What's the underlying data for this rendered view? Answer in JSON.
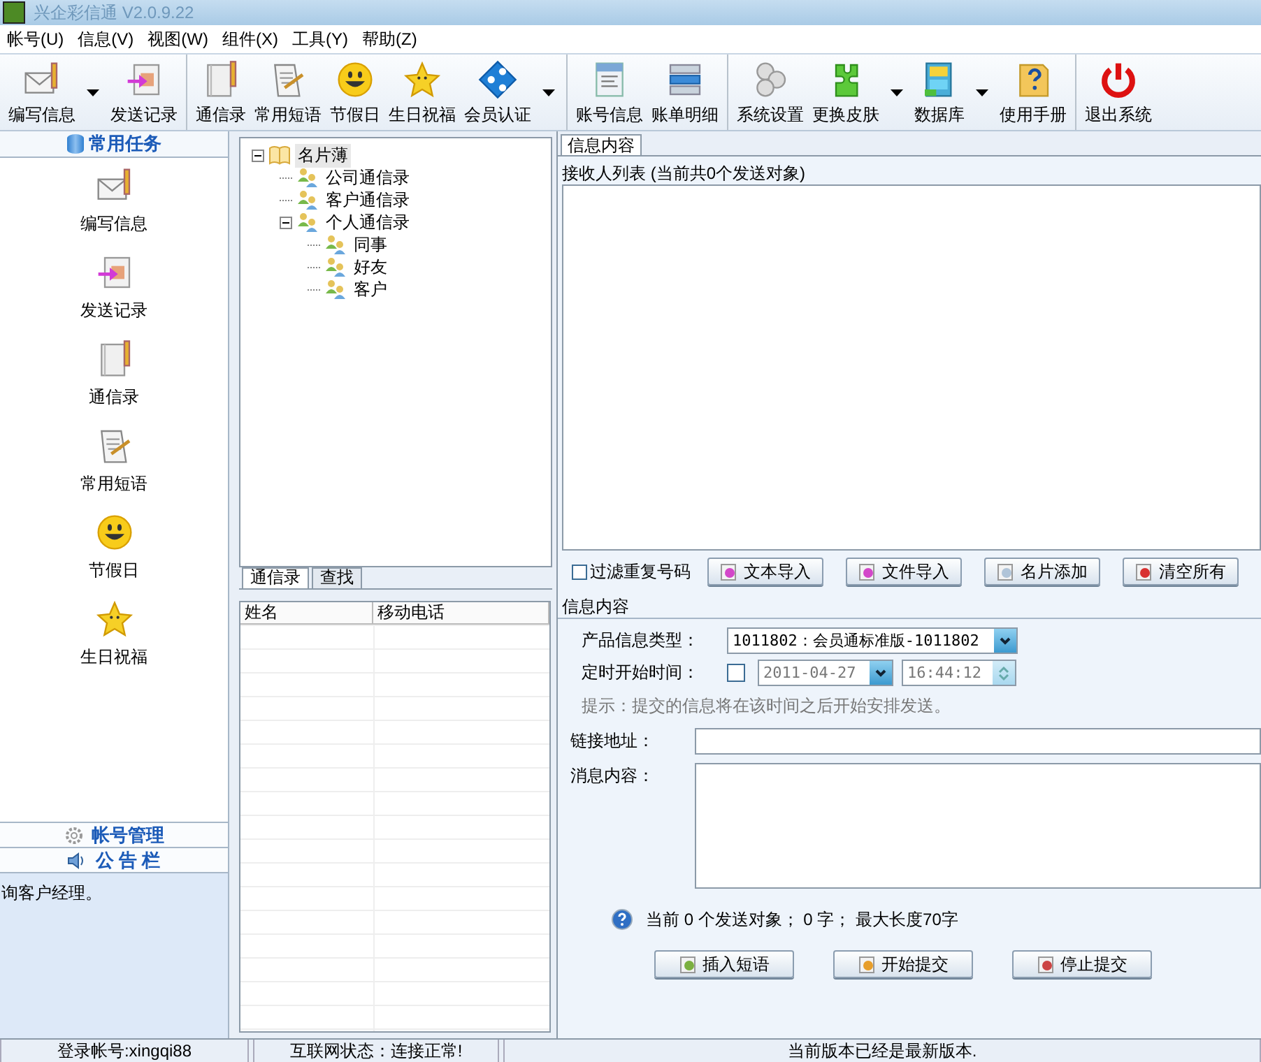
{
  "window": {
    "title": "兴企彩信通 V2.0.9.22"
  },
  "menu": [
    "帐号(U)",
    "信息(V)",
    "视图(W)",
    "组件(X)",
    "工具(Y)",
    "帮助(Z)"
  ],
  "toolbar": {
    "groups": [
      [
        {
          "label": "编写信息",
          "has_menu": true
        },
        {
          "label": "发送记录",
          "has_menu": false
        }
      ],
      [
        {
          "label": "通信录",
          "has_menu": false
        },
        {
          "label": "常用短语",
          "has_menu": false
        },
        {
          "label": "节假日",
          "has_menu": false
        },
        {
          "label": "生日祝福",
          "has_menu": false
        },
        {
          "label": "会员认证",
          "has_menu": true
        }
      ],
      [
        {
          "label": "账号信息",
          "has_menu": false
        },
        {
          "label": "账单明细",
          "has_menu": false
        }
      ],
      [
        {
          "label": "系统设置",
          "has_menu": false
        },
        {
          "label": "更换皮肤",
          "has_menu": true
        },
        {
          "label": "数据库",
          "has_menu": true
        },
        {
          "label": "使用手册",
          "has_menu": false
        }
      ],
      [
        {
          "label": "退出系统",
          "has_menu": false
        }
      ]
    ]
  },
  "sidebar": {
    "header": "常用任务",
    "items": [
      "编写信息",
      "发送记录",
      "通信录",
      "常用短语",
      "节假日",
      "生日祝福"
    ],
    "sections": [
      "帐号管理",
      "公 告 栏"
    ],
    "notice": "询客户经理。"
  },
  "tree": {
    "nodes": [
      {
        "label": "名片薄",
        "expanded": true,
        "selected": true,
        "children": [
          {
            "label": "公司通信录",
            "selected": false
          },
          {
            "label": "客户通信录",
            "selected": false
          },
          {
            "label": "个人通信录",
            "expanded": true,
            "selected": false,
            "children": [
              {
                "label": "同事",
                "selected": false
              },
              {
                "label": "好友",
                "selected": false
              },
              {
                "label": "客户",
                "selected": false
              }
            ]
          }
        ]
      }
    ]
  },
  "contacts": {
    "tabs": [
      {
        "label": "通信录",
        "selected": true
      },
      {
        "label": "查找",
        "selected": false
      }
    ],
    "columns": [
      "姓名",
      "移动电话"
    ]
  },
  "message": {
    "tab": {
      "label": "信息内容",
      "selected": true
    },
    "recipients_label": "接收人列表 (当前共0个发送对象)",
    "filter": {
      "label": "过滤重复号码",
      "checked": false
    },
    "actions": [
      "文本导入",
      "文件导入",
      "名片添加",
      "清空所有"
    ],
    "section_title": "信息内容",
    "product_type": {
      "label": "产品信息类型：",
      "value": "1011802：会员通标准版-1011802"
    },
    "schedule": {
      "label": "定时开始时间：",
      "checked": false,
      "date": "2011-04-27",
      "time": "16:44:12",
      "disabled": true
    },
    "hint": "提示：提交的信息将在该时间之后开始安排发送。",
    "link": {
      "label": "链接地址："
    },
    "content": {
      "label": "消息内容："
    },
    "counter": "当前 0 个发送对象； 0 字； 最大长度70字",
    "buttons": [
      "插入短语",
      "开始提交",
      "停止提交"
    ]
  },
  "status_bar": [
    "登录帐号:xingqi88",
    "互联网状态：连接正常!",
    "当前版本已经是最新版本."
  ]
}
